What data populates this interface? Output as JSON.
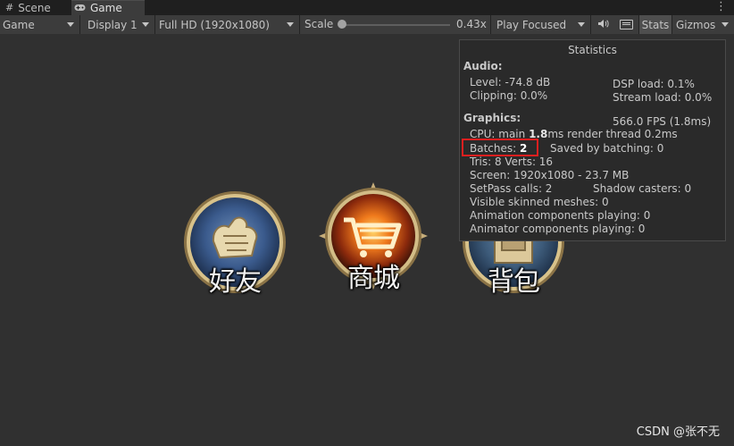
{
  "tabs": [
    {
      "label": "Scene",
      "icon": "grid-icon"
    },
    {
      "label": "Game",
      "icon": "gamepad-icon",
      "active": true
    }
  ],
  "toolbar": {
    "game_dropdown": "Game",
    "display_dropdown": "Display 1",
    "resolution_dropdown": "Full HD (1920x1080)",
    "scale_label": "Scale",
    "scale_value": "0.43x",
    "play_mode_dropdown": "Play Focused",
    "audio_icon": "speaker-icon",
    "keyboard_icon": "keyboard-icon",
    "stats_label": "Stats",
    "gizmos_label": "Gizmos"
  },
  "game": {
    "icons": [
      {
        "label": "好友",
        "icon": "handshake-icon",
        "accent": "#3a5a8c"
      },
      {
        "label": "商城",
        "icon": "shopping-cart-icon",
        "accent": "#e86a1a"
      },
      {
        "label": "背包",
        "icon": "backpack-icon",
        "accent": "#3d5b7a"
      }
    ]
  },
  "stats": {
    "title": "Statistics",
    "audio_header": "Audio:",
    "level": "Level: -74.8 dB",
    "dsp_load": "DSP load: 0.1%",
    "clipping": "Clipping: 0.0%",
    "stream_load": "Stream load: 0.0%",
    "graphics_header": "Graphics:",
    "fps": "566.0 FPS (1.8ms)",
    "cpu_prefix": "CPU: main ",
    "cpu_main": "1.8",
    "cpu_suffix": "ms  render thread 0.2ms",
    "batches_prefix": "Batches: ",
    "batches_value": "2",
    "saved_by_batching": "Saved by batching: 0",
    "tris_verts": "Tris: 8   Verts: 16",
    "screen": "Screen: 1920x1080 - 23.7 MB",
    "setpass": "SetPass calls: 2",
    "shadow_casters": "Shadow casters: 0",
    "skinned_meshes": "Visible skinned meshes: 0",
    "anim_components": "Animation components playing: 0",
    "animator_components": "Animator components playing: 0",
    "highlight_color": "#e01f1f"
  },
  "watermark": "CSDN @张不无"
}
